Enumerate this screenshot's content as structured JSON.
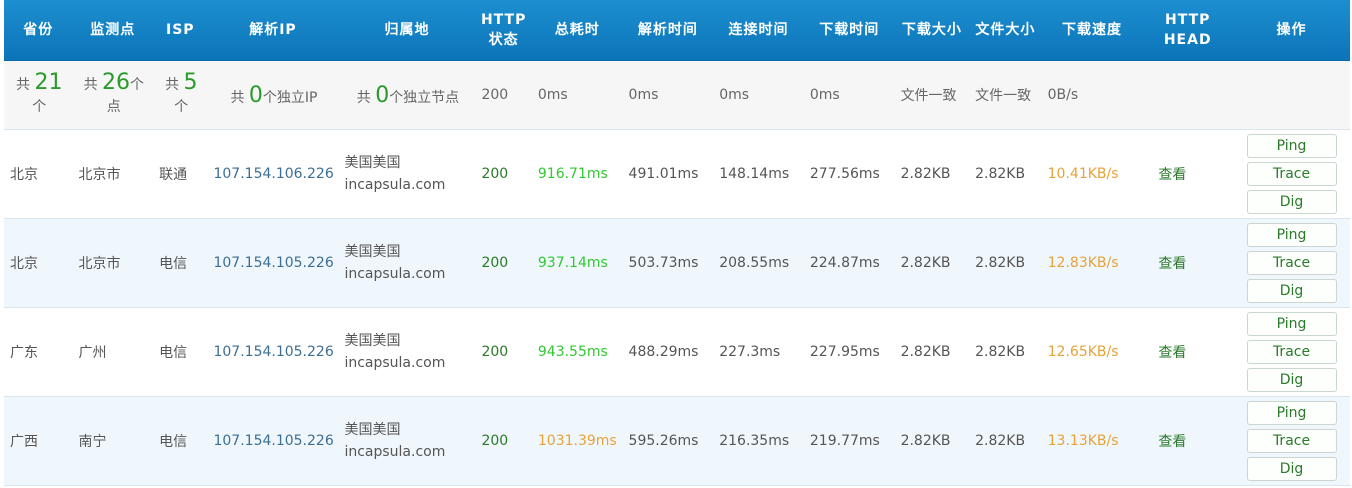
{
  "headers": {
    "province": "省份",
    "monitor": "监测点",
    "isp": "ISP",
    "resolved_ip": "解析IP",
    "location": "归属地",
    "http_status": "HTTP状态",
    "total_time": "总耗时",
    "resolve_time": "解析时间",
    "connect_time": "连接时间",
    "download_time": "下载时间",
    "download_size": "下载大小",
    "file_size": "文件大小",
    "download_speed": "下载速度",
    "http_head": "HTTP HEAD",
    "actions": "操作"
  },
  "summary": {
    "gong": "共",
    "province_count": "21",
    "province_unit": "个",
    "monitor_count": "26",
    "monitor_unit": "个点",
    "isp_count": "5",
    "isp_unit": "个",
    "ip_count": "0",
    "ip_unit": "个独立IP",
    "node_count": "0",
    "node_unit": "个独立节点",
    "http_status": "200",
    "total_time": "0ms",
    "resolve_time": "0ms",
    "connect_time": "0ms",
    "download_time": "0ms",
    "download_size": "文件一致",
    "file_size": "文件一致",
    "download_speed": "0B/s"
  },
  "actions": {
    "ping": "Ping",
    "trace": "Trace",
    "dig": "Dig",
    "view": "查看"
  },
  "rows": [
    {
      "province": "北京",
      "city": "北京市",
      "isp": "联通",
      "ip": "107.154.106.226",
      "location_line1": "美国美国",
      "location_line2": "incapsula.com",
      "status": "200",
      "total": "916.71ms",
      "total_color": "green",
      "resolve": "491.01ms",
      "connect": "148.14ms",
      "download": "277.56ms",
      "dl_size": "2.82KB",
      "file_size": "2.82KB",
      "speed": "10.41KB/s"
    },
    {
      "province": "北京",
      "city": "北京市",
      "isp": "电信",
      "ip": "107.154.105.226",
      "location_line1": "美国美国",
      "location_line2": "incapsula.com",
      "status": "200",
      "total": "937.14ms",
      "total_color": "green",
      "resolve": "503.73ms",
      "connect": "208.55ms",
      "download": "224.87ms",
      "dl_size": "2.82KB",
      "file_size": "2.82KB",
      "speed": "12.83KB/s"
    },
    {
      "province": "广东",
      "city": "广州",
      "isp": "电信",
      "ip": "107.154.105.226",
      "location_line1": "美国美国",
      "location_line2": "incapsula.com",
      "status": "200",
      "total": "943.55ms",
      "total_color": "green",
      "resolve": "488.29ms",
      "connect": "227.3ms",
      "download": "227.95ms",
      "dl_size": "2.82KB",
      "file_size": "2.82KB",
      "speed": "12.65KB/s"
    },
    {
      "province": "广西",
      "city": "南宁",
      "isp": "电信",
      "ip": "107.154.105.226",
      "location_line1": "美国美国",
      "location_line2": "incapsula.com",
      "status": "200",
      "total": "1031.39ms",
      "total_color": "orange",
      "resolve": "595.26ms",
      "connect": "216.35ms",
      "download": "219.77ms",
      "dl_size": "2.82KB",
      "file_size": "2.82KB",
      "speed": "13.13KB/s"
    }
  ]
}
